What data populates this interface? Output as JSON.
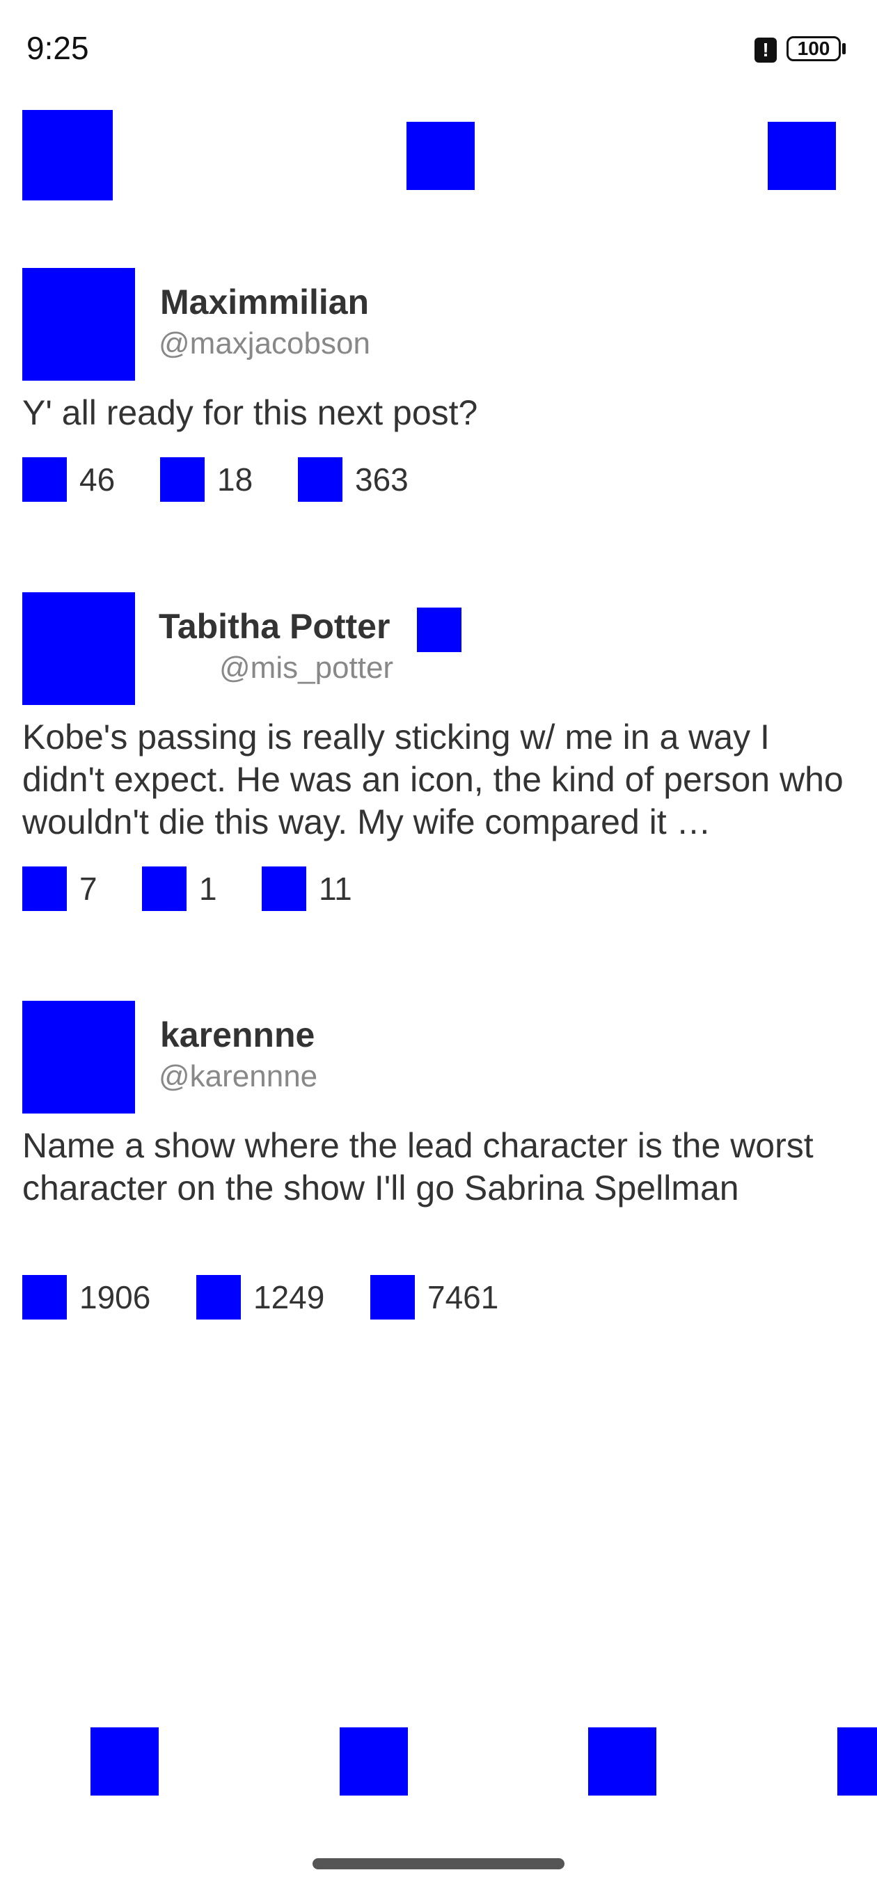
{
  "status_bar": {
    "time": "9:25",
    "battery": "100",
    "alert": "!"
  },
  "colors": {
    "placeholder": "#0000ff",
    "text": "#333333",
    "handle": "#888888"
  },
  "toolbar": {
    "left_icon": "menu-icon",
    "center_icon": "app-logo-icon",
    "right_icon": "compose-icon"
  },
  "posts": [
    {
      "name": "Maximmilian",
      "handle": "@maxjacobson",
      "text": "Y' all ready for this next post?",
      "stats": [
        "46",
        "18",
        "363"
      ]
    },
    {
      "name": "Tabitha Potter",
      "handle": "@mis_potter",
      "verified_icon": "verified-badge-icon",
      "text": "Kobe's passing is really sticking w/ me in a way I didn't expect. He was an icon, the kind of person who wouldn't die this way. My wife compared it …",
      "stats": [
        "7",
        "1",
        "11"
      ]
    },
    {
      "name": "karennne",
      "handle": "@karennne",
      "text": "Name a show where the lead character is the worst character on the show I'll go Sabrina Spellman",
      "stats": [
        "1906",
        "1249",
        "7461"
      ]
    }
  ],
  "bottom_nav": [
    "home-icon",
    "search-icon",
    "notifications-icon",
    "messages-icon"
  ]
}
